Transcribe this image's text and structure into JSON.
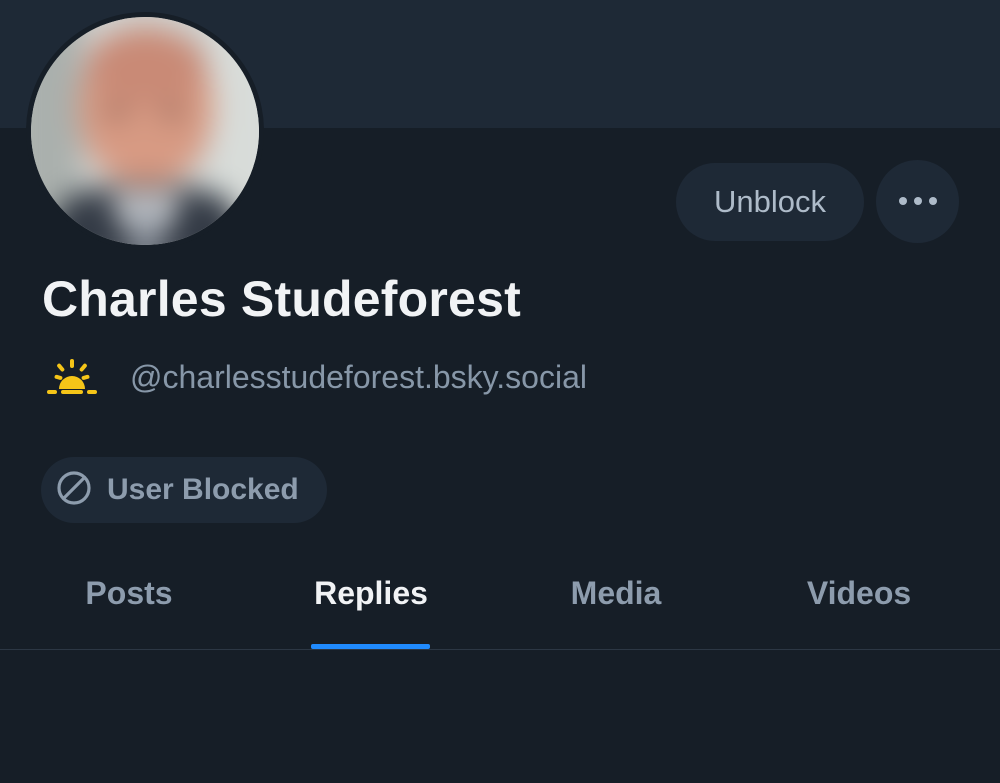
{
  "profile": {
    "display_name": "Charles Studeforest",
    "handle": "@charlesstudeforest.bsky.social",
    "avatar_icon": "blurred-profile-photo",
    "handle_badge_icon": "sunrise-icon"
  },
  "actions": {
    "unblock_label": "Unblock",
    "more_icon": "more-horizontal-icon"
  },
  "status": {
    "blocked_label": "User Blocked",
    "blocked_icon": "block-circle-icon"
  },
  "tabs": [
    {
      "label": "Posts",
      "active": false
    },
    {
      "label": "Replies",
      "active": true
    },
    {
      "label": "Media",
      "active": false
    },
    {
      "label": "Videos",
      "active": false
    }
  ],
  "colors": {
    "background": "#161e27",
    "banner": "#1e2936",
    "accent": "#208bfe",
    "sun": "#f5c518"
  }
}
